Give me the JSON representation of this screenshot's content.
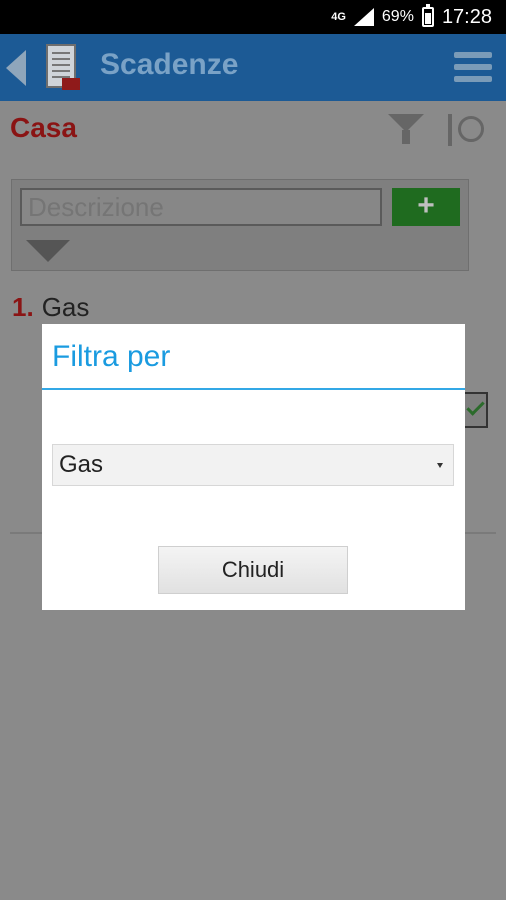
{
  "status_bar": {
    "network": "4G",
    "battery_percent": "69%",
    "time": "17:28"
  },
  "app_bar": {
    "title": "Scadenze"
  },
  "page": {
    "section_title": "Casa",
    "description_placeholder": "Descrizione",
    "add_button_label": "+",
    "list_items": [
      {
        "number": "1.",
        "label": "Gas"
      }
    ]
  },
  "dialog": {
    "title": "Filtra per",
    "selected_option": "Gas",
    "close_button_label": "Chiudi"
  },
  "colors": {
    "app_bar": "#1c5a95",
    "section_title": "#8a1414",
    "dialog_accent": "#1a9be0",
    "add_button": "#1f6b1f"
  }
}
